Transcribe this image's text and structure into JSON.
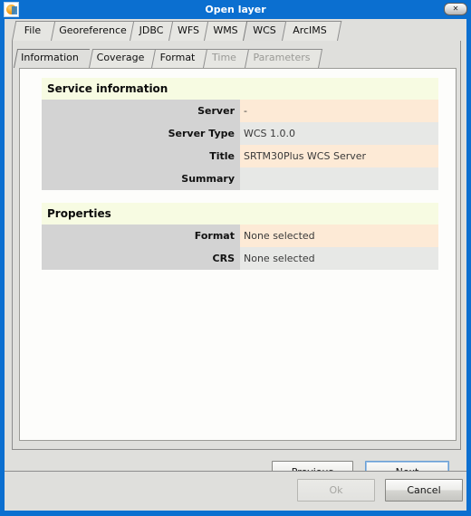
{
  "window": {
    "title": "Open layer",
    "icon": "app-globe-icon",
    "close_label": "✕",
    "accent_blue": "#0b6fd0",
    "panel_grey": "#dfdfdc"
  },
  "outer_tabs": [
    {
      "label": "File",
      "selected": false,
      "disabled": false
    },
    {
      "label": "Georeference",
      "selected": false,
      "disabled": false
    },
    {
      "label": "JDBC",
      "selected": false,
      "disabled": false
    },
    {
      "label": "WFS",
      "selected": false,
      "disabled": false
    },
    {
      "label": "WMS",
      "selected": false,
      "disabled": false
    },
    {
      "label": "WCS",
      "selected": true,
      "disabled": false
    },
    {
      "label": "ArcIMS",
      "selected": false,
      "disabled": false
    }
  ],
  "inner_tabs": [
    {
      "label": "Information",
      "selected": true,
      "disabled": false
    },
    {
      "label": "Coverage",
      "selected": false,
      "disabled": false
    },
    {
      "label": "Format",
      "selected": false,
      "disabled": false
    },
    {
      "label": "Time",
      "selected": false,
      "disabled": true
    },
    {
      "label": "Parameters",
      "selected": false,
      "disabled": true
    }
  ],
  "sections": [
    {
      "heading": "Service information",
      "rows": [
        {
          "key": "Server",
          "value": "-"
        },
        {
          "key": "Server Type",
          "value": "WCS 1.0.0"
        },
        {
          "key": "Title",
          "value": "SRTM30Plus WCS Server"
        },
        {
          "key": "Summary",
          "value": ""
        }
      ]
    },
    {
      "heading": "Properties",
      "rows": [
        {
          "key": "Format",
          "value": "None selected"
        },
        {
          "key": "CRS",
          "value": "None selected"
        }
      ]
    }
  ],
  "nav_buttons": {
    "previous": "Previous",
    "next": "Next"
  },
  "dialog_buttons": {
    "ok": "Ok",
    "cancel": "Cancel"
  }
}
